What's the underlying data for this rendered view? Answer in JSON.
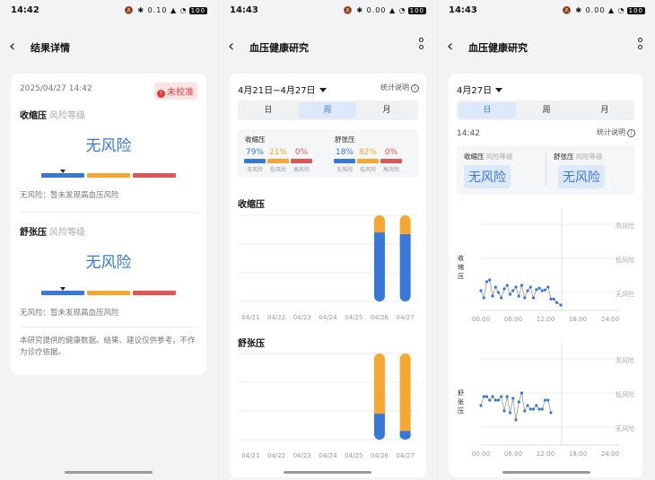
{
  "s1": {
    "time": "14:42",
    "battery": "100",
    "net": "0.10",
    "title": "结果详情",
    "date": "2025/04/27 14:42",
    "badge": "未校准",
    "sys_title": "收缩压",
    "sys_sub": "风险等级",
    "sys_risk": "无风险",
    "sys_note": "无风险：暂未发现高血压风险",
    "dia_title": "舒张压",
    "dia_sub": "风险等级",
    "dia_risk": "无风险",
    "dia_note": "无风险：暂未发现高血压风险",
    "footer": "本研究提供的健康数据、结果、建议仅供参考，不作为诊疗依据。"
  },
  "s2": {
    "time": "14:43",
    "battery": "100",
    "net": "0.00",
    "title": "血压健康研究",
    "range": "4月21日~4月27日",
    "explain": "统计说明",
    "tabs": [
      "日",
      "周",
      "月"
    ],
    "sys": {
      "label": "收缩压",
      "values": [
        "79%",
        "21%",
        "0%"
      ],
      "labels": [
        "无风险",
        "低风险",
        "高风险"
      ]
    },
    "dia": {
      "label": "舒张压",
      "values": [
        "18%",
        "82%",
        "0%"
      ],
      "labels": [
        "无风险",
        "低风险",
        "高风险"
      ]
    },
    "sys_chart_title": "收缩压",
    "dia_chart_title": "舒张压"
  },
  "s3": {
    "time": "14:43",
    "battery": "100",
    "net": "0.00",
    "title": "血压健康研究",
    "date": "4月27日",
    "tabs": [
      "日",
      "周",
      "月"
    ],
    "clock": "14:42",
    "explain": "统计说明",
    "sys_label": "收缩压",
    "sys_sub": "风险等级",
    "sys_val": "无风险",
    "dia_label": "舒张压",
    "dia_sub": "风险等级",
    "dia_val": "无风险",
    "sys_axis": "收缩压",
    "dia_axis": "舒张压",
    "levels": [
      "高风险",
      "低风险",
      "无风险"
    ]
  },
  "colors": {
    "blue": "#3a78d8",
    "orange": "#f4a733",
    "red": "#e05656"
  },
  "chart_data": [
    {
      "type": "bar",
      "title": "收缩压",
      "categories": [
        "04/21",
        "04/22",
        "04/23",
        "04/24",
        "04/25",
        "04/26",
        "04/27"
      ],
      "series": [
        {
          "values": [
            0,
            0,
            0,
            0,
            0,
            0.8,
            0.78
          ]
        },
        {
          "values": [
            0,
            0,
            0,
            0,
            0,
            0.2,
            0.22
          ]
        }
      ]
    },
    {
      "type": "bar",
      "title": "舒张压",
      "categories": [
        "04/21",
        "04/22",
        "04/23",
        "04/24",
        "04/25",
        "04/26",
        "04/27"
      ],
      "series": [
        {
          "values": [
            0,
            0,
            0,
            0,
            0,
            0.3,
            0.1
          ]
        },
        {
          "values": [
            0,
            0,
            0,
            0,
            0,
            0.7,
            0.9
          ]
        }
      ]
    },
    {
      "type": "line",
      "title": "",
      "xlabel": "",
      "ylabel": "收缩压",
      "x_ticks": [
        "00:00",
        "06:00",
        "12:00",
        "18:00",
        "24:00"
      ],
      "y_levels": [
        "高风险",
        "低风险",
        "无风险"
      ],
      "x": [
        0.0,
        0.5,
        1.0,
        1.5,
        2.0,
        2.5,
        3.0,
        3.5,
        4.0,
        4.5,
        5.0,
        5.5,
        6.0,
        6.5,
        7.0,
        7.5,
        8.0,
        8.5,
        9.0,
        9.5,
        10.0,
        10.5,
        11.0,
        11.5,
        12.0,
        12.5,
        13.0,
        13.7
      ],
      "y": [
        0.45,
        0.25,
        0.7,
        0.75,
        0.3,
        0.55,
        0.4,
        0.25,
        0.5,
        0.6,
        0.35,
        0.45,
        0.55,
        0.3,
        0.6,
        0.25,
        0.45,
        0.55,
        0.25,
        0.48,
        0.52,
        0.45,
        0.47,
        0.55,
        0.22,
        0.22,
        0.12,
        0.05
      ]
    },
    {
      "type": "line",
      "title": "",
      "xlabel": "",
      "ylabel": "舒张压",
      "x_ticks": [
        "00:00",
        "06:00",
        "12:00",
        "18:00",
        "24:00"
      ],
      "y_levels": [
        "高风险",
        "低风险",
        "无风险"
      ],
      "x": [
        0.0,
        0.5,
        1.0,
        1.5,
        2.0,
        2.5,
        3.0,
        3.5,
        4.0,
        4.5,
        5.0,
        5.5,
        6.0,
        6.5,
        7.0,
        7.5,
        8.0,
        8.5,
        9.0,
        9.5,
        10.0,
        10.5,
        11.0,
        11.5,
        12.0,
        12.5,
        13.0,
        13.7
      ],
      "y": [
        1.0,
        1.25,
        1.25,
        1.15,
        1.25,
        1.15,
        1.15,
        1.25,
        0.85,
        1.25,
        0.8,
        1.2,
        0.6,
        1.1,
        1.35,
        0.85,
        1.0,
        0.9,
        0.9,
        1.0,
        0.9,
        0.9,
        1.15,
        1.15,
        0.8
      ]
    }
  ]
}
